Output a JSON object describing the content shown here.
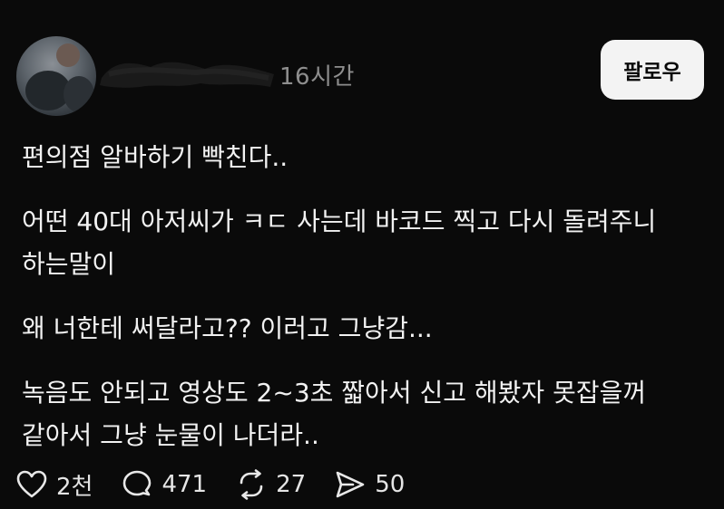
{
  "post": {
    "time_ago": "16시간",
    "follow_label": "팔로우",
    "paragraphs": [
      {
        "lines": [
          "편의점 알바하기 빡친다.."
        ]
      },
      {
        "lines": [
          "어떤 40대 아저씨가 ㅋㄷ 사는데 바코드 찍고 다시 돌려주니",
          "하는말이"
        ]
      },
      {
        "lines": [
          "왜 너한테 써달라고?? 이러고 그냥감..."
        ]
      },
      {
        "lines": [
          "녹음도 안되고 영상도 2~3초 짧아서 신고 해봤자 못잡을꺼",
          "같아서 그냥 눈물이 나더라.."
        ]
      }
    ],
    "actions": {
      "likes": "2천",
      "comments": "471",
      "reposts": "27",
      "shares": "50"
    },
    "icons": {
      "like": "heart-icon",
      "comment": "comment-bubble-icon",
      "repost": "repost-icon",
      "share": "send-icon"
    }
  }
}
